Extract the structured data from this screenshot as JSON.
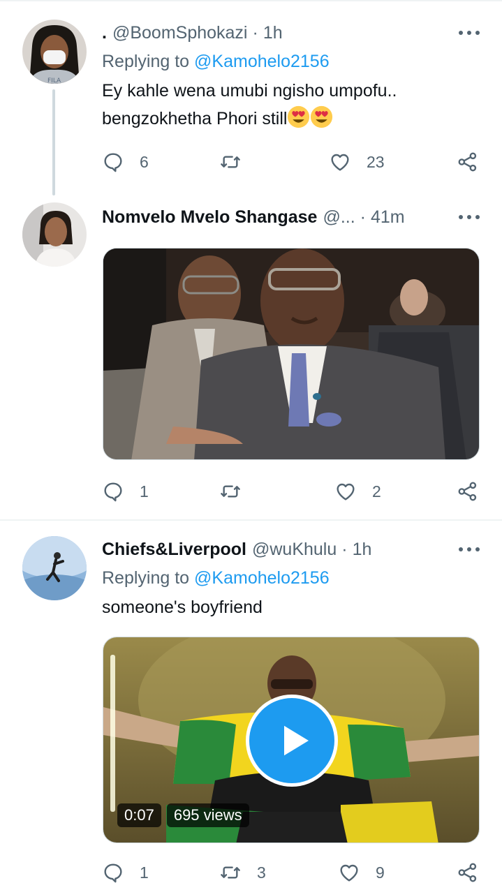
{
  "tweets": [
    {
      "display_name": ".",
      "handle": "@BoomSphokazi",
      "separator": "·",
      "time": "1h",
      "replying_label": "Replying to",
      "replying_to": "@Kamohelo2156",
      "text_line1": "Ey kahle wena umubi ngisho umpofu..",
      "text_line2": "bengzokhetha Phori still",
      "emojis": [
        "smiling-face-with-heart-eyes",
        "smiling-face-with-heart-eyes"
      ],
      "replies": "6",
      "retweets": "",
      "likes": "23"
    },
    {
      "display_name": "Nomvelo Mvelo Shangase",
      "handle": "@...",
      "separator": "·",
      "time": "41m",
      "replies": "1",
      "retweets": "",
      "likes": "2"
    },
    {
      "display_name": "Chiefs&Liverpool",
      "handle": "@wuKhulu",
      "separator": "·",
      "time": "1h",
      "replying_label": "Replying to",
      "replying_to": "@Kamohelo2156",
      "text_line1": "someone's boyfriend",
      "video": {
        "duration": "0:07",
        "views": "695 views"
      },
      "replies": "1",
      "retweets": "3",
      "likes": "9"
    }
  ],
  "icons": {
    "reply": "speech-bubble-icon",
    "retweet": "retweet-arrows-icon",
    "like": "heart-icon",
    "share": "share-nodes-icon",
    "more": "more-dots-icon",
    "play": "play-icon"
  },
  "colors": {
    "accent": "#1d9bf0",
    "secondary_text": "#536471",
    "primary_text": "#0f1419",
    "divider": "#eff3f4"
  }
}
